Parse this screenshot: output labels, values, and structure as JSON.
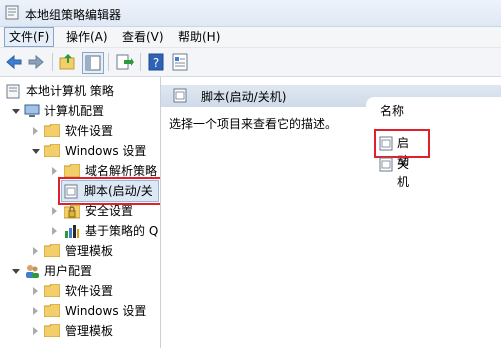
{
  "window": {
    "title": "本地组策略编辑器"
  },
  "menu": {
    "file": "文件(F)",
    "action": "操作(A)",
    "view": "查看(V)",
    "help": "帮助(H)"
  },
  "toolbar": {
    "buttons": [
      "back-arrow-icon",
      "forward-arrow-icon",
      "up-folder-icon",
      "show-hide-tree-icon",
      "export-list-icon",
      "help-icon",
      "properties-icon"
    ]
  },
  "tree": {
    "root": "本地计算机 策略",
    "computer_config": "计算机配置",
    "software_settings": "软件设置",
    "windows_settings": "Windows 设置",
    "dns_policy": "域名解析策略",
    "scripts": "脚本(启动/关",
    "security_settings": "安全设置",
    "policy_qos": "基于策略的 Q",
    "admin_templates": "管理模板",
    "user_config": "用户配置",
    "user_software_settings": "软件设置",
    "user_windows_settings": "Windows 设置",
    "user_admin_templates": "管理模板"
  },
  "right": {
    "header_title": "脚本(启动/关机)",
    "description": "选择一个项目来查看它的描述。",
    "column_name": "名称",
    "items": [
      "启动",
      "关机"
    ]
  },
  "colors": {
    "highlight": "#e0202a",
    "folder": "#f2cf6b"
  }
}
